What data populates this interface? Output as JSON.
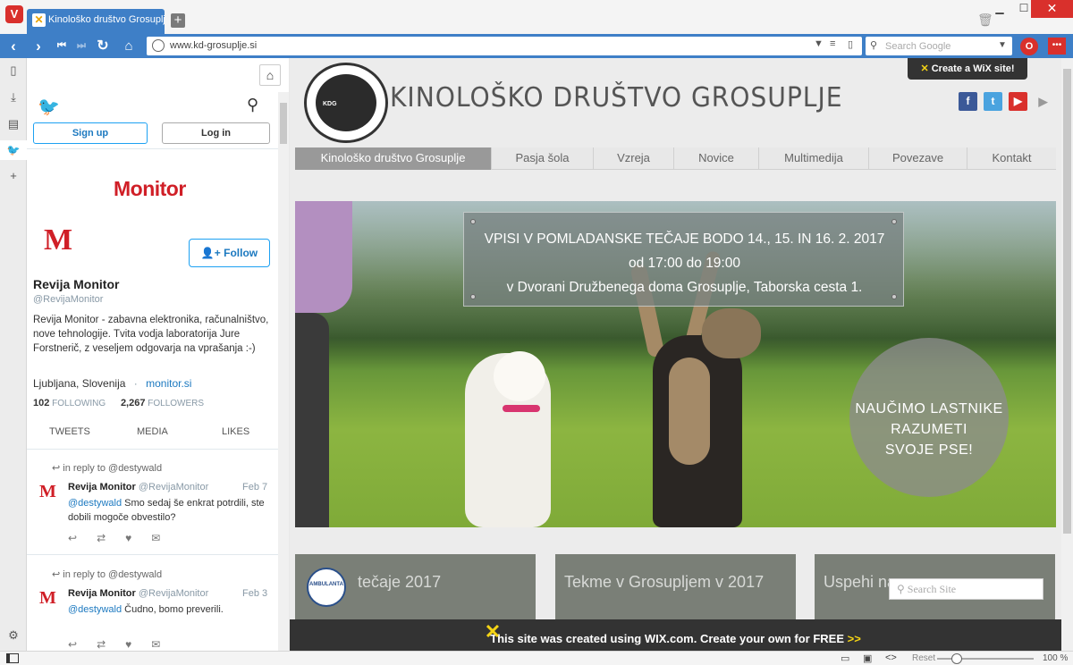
{
  "browser": {
    "tab_title": "Kinološko društvo Grosuplje",
    "new_tab_label": "+",
    "url": "www.kd-grosuplje.si",
    "search_placeholder": "Search Google",
    "zoom_reset_label": "Reset",
    "zoom_level": "100 %",
    "accent_color": "#3e7fc7"
  },
  "twitter": {
    "sign_up_label": "Sign up",
    "log_in_label": "Log in",
    "banner_logo": "Monitor",
    "avatar_letter": "M",
    "follow_label": "Follow",
    "name": "Revija Monitor",
    "handle": "@RevijaMonitor",
    "bio": "Revija Monitor - zabavna elektronika, računalništvo, nove tehnologije. Tvita vodja laboratorija Jure Forstnerič, z veseljem odgovarja na vprašanja :-)",
    "location": "Ljubljana, Slovenija",
    "location_separator": "·",
    "website": "monitor.si",
    "following_count": "102",
    "following_label": "FOLLOWING",
    "followers_count": "2,267",
    "followers_label": "FOLLOWERS",
    "tabs": [
      "TWEETS",
      "MEDIA",
      "LIKES"
    ],
    "tweets": [
      {
        "reply_to": "in reply to @destywald",
        "author": "Revija Monitor",
        "handle": "@RevijaMonitor",
        "date": "Feb 7",
        "mention": "@destywald",
        "text": "Smo sedaj še enkrat potrdili, ste dobili mogoče obvestilo?"
      },
      {
        "reply_to": "in reply to @destywald",
        "author": "Revija Monitor",
        "handle": "@RevijaMonitor",
        "date": "Feb 3",
        "mention": "@destywald",
        "text": "Čudno, bomo preverili."
      }
    ]
  },
  "site": {
    "title": "KINOLOŠKO DRUŠTVO GROSUPLJE",
    "logo_text": "KDG",
    "wix_badge": "Create a WiX site!",
    "nav": [
      "Kinološko društvo Grosuplje",
      "Pasja šola",
      "Vzreja",
      "Novice",
      "Multimedija",
      "Povezave",
      "Kontakt"
    ],
    "hero_lines": [
      "VPISI V POMLADANSKE TEČAJE BODO 14., 15. IN 16. 2. 2017",
      "od 17:00 do 19:00",
      "v Dvorani Družbenega doma Grosuplje, Taborska cesta 1."
    ],
    "hero_circle_lines": [
      "NAUČIMO LASTNIKE",
      "RAZUMETI",
      "SVOJE PSE!"
    ],
    "cards": [
      "tečaje 2017",
      "Tekme v Grosupljem v 2017",
      "Uspehi na"
    ],
    "card1_logo_text": "AMBULANTA",
    "search_placeholder": "Search Site",
    "footer_text": "This site was created using WIX.com. Create your own for FREE",
    "footer_arrows": ">>"
  }
}
